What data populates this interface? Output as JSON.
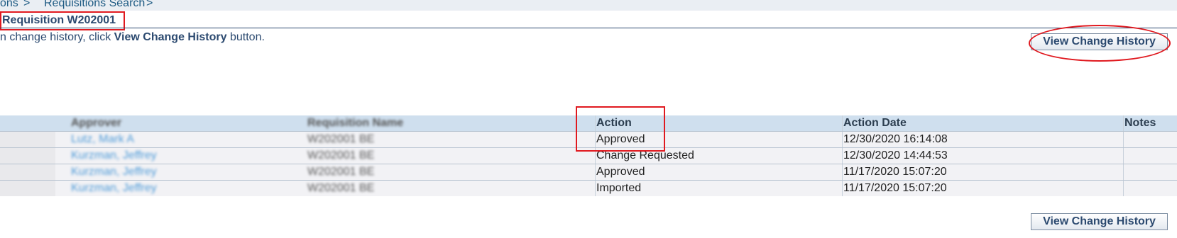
{
  "breadcrumb": {
    "items": [
      "ons",
      ">",
      "Requisitions Search",
      ">"
    ]
  },
  "page_title": "Requisition W202001",
  "instruction": {
    "prefix": "n change history, click ",
    "bold": "View Change History",
    "suffix": " button."
  },
  "buttons": {
    "view_change_history_top": "View Change History",
    "view_change_history_bottom": "View Change History"
  },
  "table": {
    "columns": [
      "Approver",
      "Requisition Name",
      "Action",
      "Action Date",
      "Notes"
    ],
    "rows": [
      {
        "approver": "Lutz, Mark A",
        "requisition_name": "W202001 BE",
        "action": "Approved",
        "action_date": "12/30/2020 16:14:08",
        "notes": ""
      },
      {
        "approver": "Kurzman, Jeffrey",
        "requisition_name": "W202001 BE",
        "action": "Change Requested",
        "action_date": "12/30/2020 14:44:53",
        "notes": ""
      },
      {
        "approver": "Kurzman, Jeffrey",
        "requisition_name": "W202001 BE",
        "action": "Approved",
        "action_date": "11/17/2020 15:07:20",
        "notes": ""
      },
      {
        "approver": "Kurzman, Jeffrey",
        "requisition_name": "W202001 BE",
        "action": "Imported",
        "action_date": "11/17/2020 15:07:20",
        "notes": ""
      }
    ]
  },
  "colors": {
    "highlight": "#e0191f",
    "header_bg": "#cfdfee",
    "title_color": "#2c4a70"
  }
}
